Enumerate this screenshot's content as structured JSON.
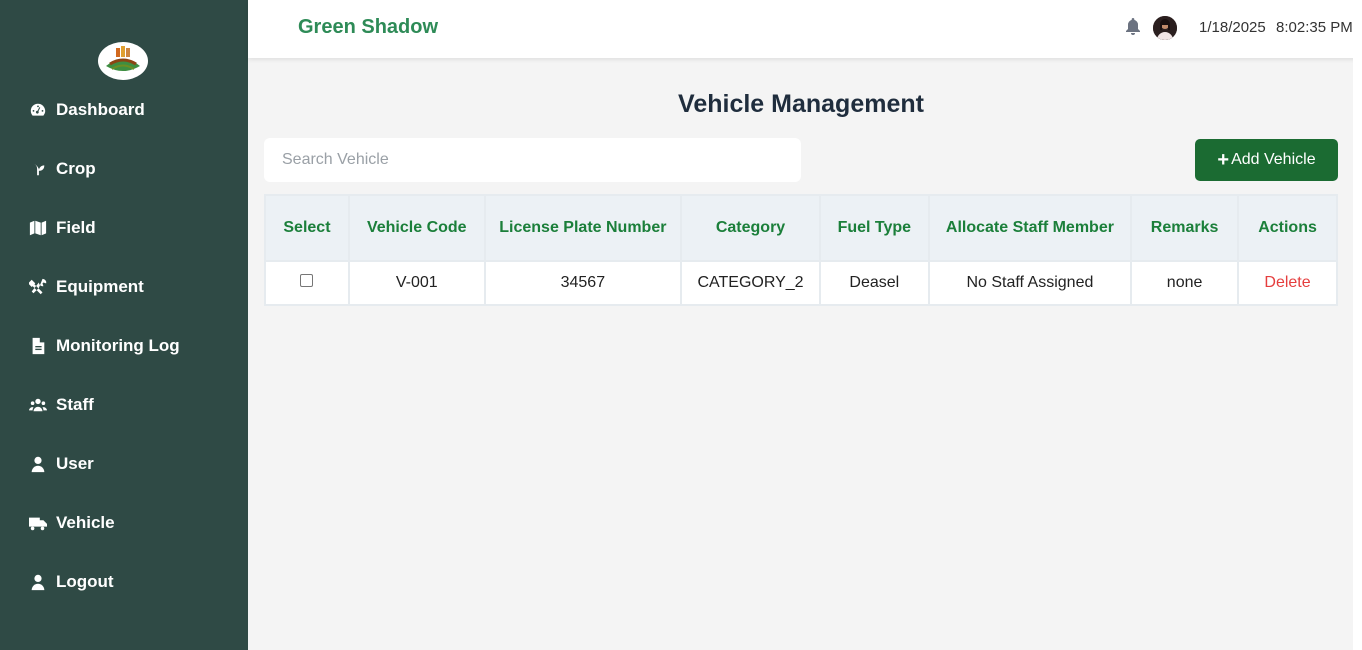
{
  "app": {
    "brand": "Green Shadow",
    "date": "1/18/2025",
    "time": "8:02:35 PM"
  },
  "sidebar": {
    "items": [
      {
        "label": "Dashboard",
        "icon": "dashboard-icon"
      },
      {
        "label": "Crop",
        "icon": "seedling-icon"
      },
      {
        "label": "Field",
        "icon": "map-icon"
      },
      {
        "label": "Equipment",
        "icon": "tools-icon"
      },
      {
        "label": "Monitoring Log",
        "icon": "document-icon"
      },
      {
        "label": "Staff",
        "icon": "users-icon"
      },
      {
        "label": "User",
        "icon": "user-icon"
      },
      {
        "label": "Vehicle",
        "icon": "truck-icon"
      },
      {
        "label": "Logout",
        "icon": "user-icon"
      }
    ]
  },
  "main": {
    "title": "Vehicle Management",
    "search_placeholder": "Search Vehicle",
    "add_label": "Add Vehicle",
    "table": {
      "headers": [
        "Select",
        "Vehicle Code",
        "License Plate Number",
        "Category",
        "Fuel Type",
        "Allocate Staff Member",
        "Remarks",
        "Actions"
      ],
      "rows": [
        {
          "code": "V-001",
          "plate": "34567",
          "category": "CATEGORY_2",
          "fuel": "Deasel",
          "staff": "No Staff Assigned",
          "remarks": "none",
          "action": "Delete"
        }
      ]
    }
  },
  "colors": {
    "sidebar": "#2f4a45",
    "brand": "#2e8b57",
    "accent": "#1b6b32",
    "header_text": "#1b7f3a",
    "delete": "#e53e3e"
  }
}
